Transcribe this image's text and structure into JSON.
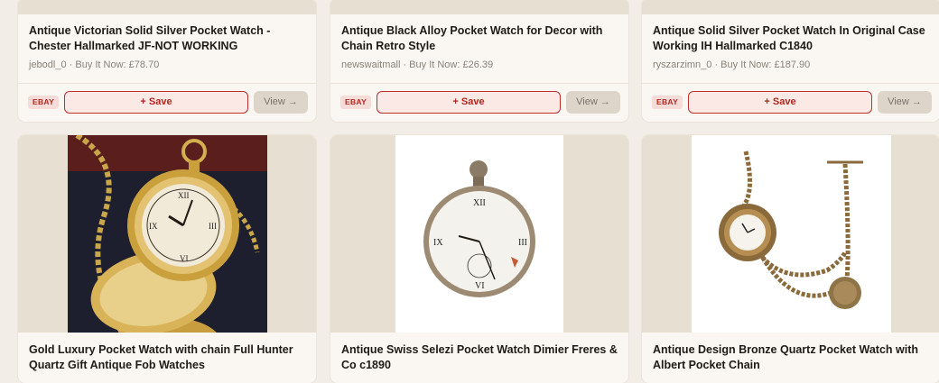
{
  "cards_top": [
    {
      "title": "Antique Victorian Solid Silver Pocket Watch - Chester Hallmarked JF-NOT WORKING",
      "meta": "jebodl_0 · Buy It Now: £78.70",
      "badge": "EBAY",
      "save_label": "+ Save",
      "view_label": "View →"
    },
    {
      "title": "Antique Black Alloy Pocket Watch for Decor with Chain Retro Style",
      "meta": "newswaitmall · Buy It Now: £26.39",
      "badge": "EBAY",
      "save_label": "+ Save",
      "view_label": "View →"
    },
    {
      "title": "Antique Solid Silver Pocket Watch In Original Case Working IH Hallmarked C1840",
      "meta": "ryszarzimn_0 · Buy It Now: £187.90",
      "badge": "EBAY",
      "save_label": "+ Save",
      "view_label": "View →"
    }
  ],
  "cards_bottom": [
    {
      "title": "Gold Luxury Pocket Watch with chain Full Hunter Quartz Gift Antique Fob Watches"
    },
    {
      "title": "Antique Swiss Selezi Pocket Watch Dimier Freres & Co c1890"
    },
    {
      "title": "Antique Design Bronze Quartz Pocket Watch with Albert Pocket Chain"
    }
  ],
  "colors": {
    "page_bg": "#f2ede6",
    "card_bg": "#faf7f2",
    "accent_red": "#b3261e",
    "badge_bg": "#f6dcd9",
    "view_bg": "#ddd5ca"
  }
}
